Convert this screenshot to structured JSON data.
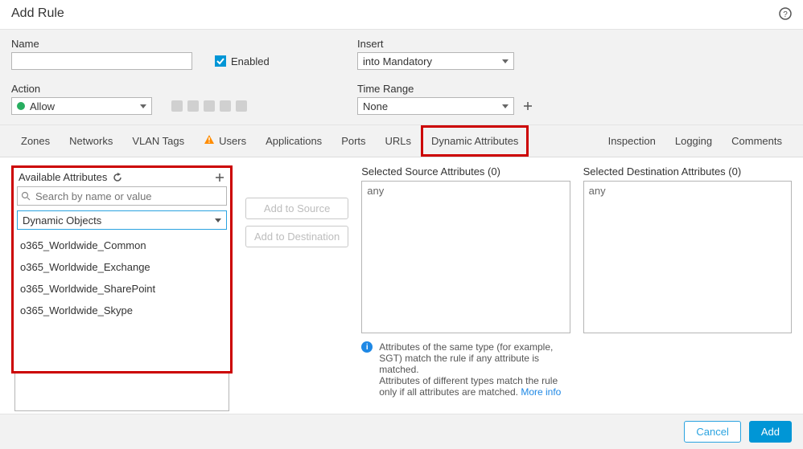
{
  "title": "Add Rule",
  "form": {
    "name_label": "Name",
    "name_value": "",
    "enabled_label": "Enabled",
    "enabled_checked": true,
    "insert_label": "Insert",
    "insert_value": "into Mandatory",
    "action_label": "Action",
    "action_value": "Allow",
    "timerange_label": "Time Range",
    "timerange_value": "None"
  },
  "tabs": {
    "left": [
      "Zones",
      "Networks",
      "VLAN Tags",
      "Users",
      "Applications",
      "Ports",
      "URLs",
      "Dynamic Attributes"
    ],
    "right": [
      "Inspection",
      "Logging",
      "Comments"
    ],
    "users_warning": true
  },
  "available": {
    "header": "Available Attributes",
    "search_placeholder": "Search by name or value",
    "type_value": "Dynamic Objects",
    "items": [
      "o365_Worldwide_Common",
      "o365_Worldwide_Exchange",
      "o365_Worldwide_SharePoint",
      "o365_Worldwide_Skype"
    ]
  },
  "buttons": {
    "add_source": "Add to Source",
    "add_destination": "Add to Destination"
  },
  "selected": {
    "source_label": "Selected Source Attributes (0)",
    "source_value": "any",
    "dest_label": "Selected Destination Attributes (0)",
    "dest_value": "any"
  },
  "hint": {
    "line1": "Attributes of the same type (for example, SGT) match the rule if any attribute is matched.",
    "line2a": "Attributes of different types match the rule only if all attributes are matched. ",
    "more": "More info"
  },
  "footer": {
    "cancel": "Cancel",
    "add": "Add"
  }
}
